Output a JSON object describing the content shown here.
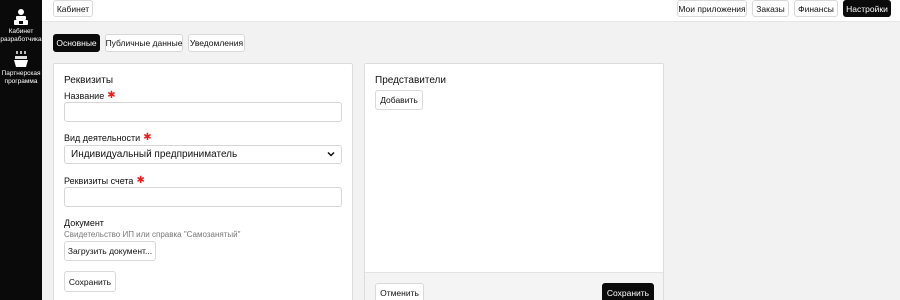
{
  "sidebar": {
    "items": [
      {
        "label_line1": "Кабинет",
        "label_line2": "разработчика",
        "icon": "developer-icon"
      },
      {
        "label_line1": "Партнерская",
        "label_line2": "программа",
        "icon": "partner-icon"
      }
    ]
  },
  "topbar": {
    "cabinet_label": "Кабинет",
    "nav": {
      "apps": "Мои приложения",
      "orders": "Заказы",
      "finance": "Финансы",
      "settings": "Настройки"
    }
  },
  "tabs": [
    {
      "label": "Основные",
      "active": true
    },
    {
      "label": "Публичные данные",
      "active": false
    },
    {
      "label": "Уведомления",
      "active": false
    }
  ],
  "requisites": {
    "title": "Реквизиты",
    "name_label": "Название",
    "name_value": "",
    "activity_label": "Вид деятельности",
    "activity_value": "Индивидуальный предприниматель",
    "account_label": "Реквизиты счета",
    "account_value": "",
    "document_label": "Документ",
    "document_hint": "Свидетельство ИП или справка \"Самозанятый\"",
    "upload_label": "Загрузить документ...",
    "save_label": "Сохранить"
  },
  "representatives": {
    "title": "Представители",
    "add_label": "Добавить",
    "cancel_label": "Отменить",
    "save_label": "Сохранить"
  },
  "colors": {
    "required_marker": "#e32222",
    "primary_button": "#0b0b0b",
    "sidebar": "#0a0a0a"
  }
}
